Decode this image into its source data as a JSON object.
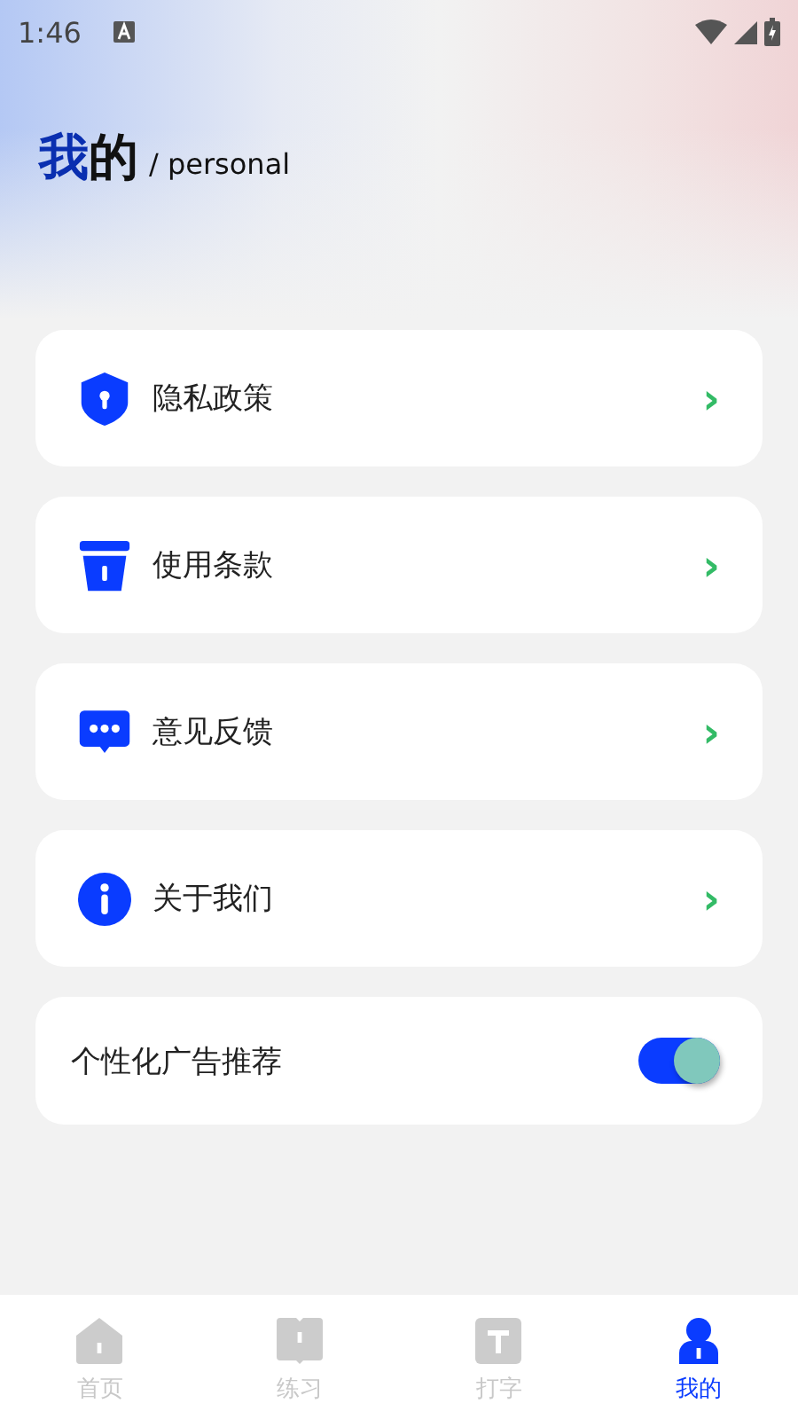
{
  "status_bar": {
    "time": "1:46"
  },
  "header": {
    "title_accent": "我",
    "title_rest": "的",
    "subtitle": "/ personal"
  },
  "menu": [
    {
      "kind": "link",
      "label": "隐私政策",
      "chevron": "›"
    },
    {
      "kind": "link",
      "label": "使用条款",
      "chevron": "›"
    },
    {
      "kind": "link",
      "label": "意见反馈",
      "chevron": "›"
    },
    {
      "kind": "link",
      "label": "关于我们",
      "chevron": "›"
    },
    {
      "kind": "toggle",
      "label": "个性化广告推荐",
      "on": true
    }
  ],
  "tabs": [
    {
      "label": "首页",
      "selected": false
    },
    {
      "label": "练习",
      "selected": false
    },
    {
      "label": "打字",
      "selected": false
    },
    {
      "label": "我的",
      "selected": true
    }
  ]
}
